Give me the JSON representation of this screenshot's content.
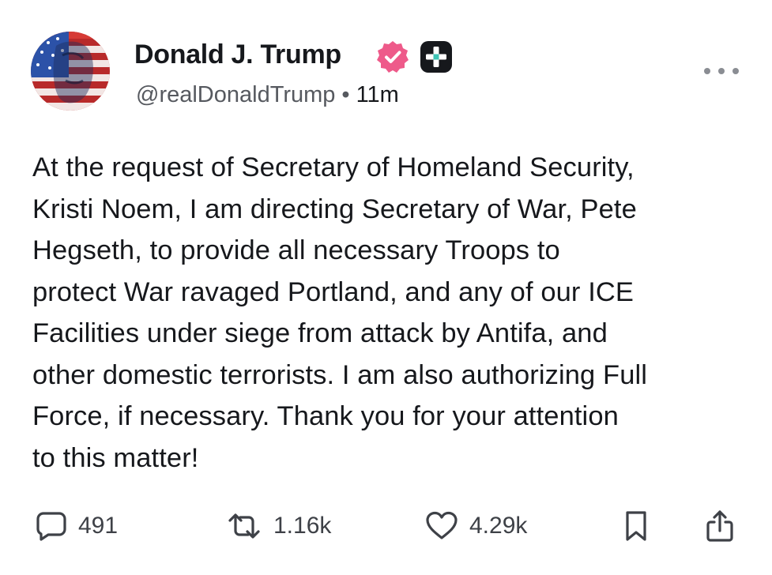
{
  "author": {
    "display_name": "Donald J. Trump",
    "handle": "@realDonaldTrump",
    "separator": "•",
    "time_ago": "11m",
    "verified_color": "#ee5a8a"
  },
  "post": {
    "text": "At the request of Secretary of Homeland Security,\nKristi Noem, I am directing Secretary of War, Pete\nHegseth, to provide all necessary Troops to\nprotect War ravaged Portland, and any of our ICE\nFacilities under siege from attack by Antifa, and\nother domestic terrorists. I am also authorizing Full\nForce, if necessary. Thank you for your attention\nto this matter!"
  },
  "actions": {
    "replies": "491",
    "retruths": "1.16k",
    "likes": "4.29k"
  },
  "icons": {
    "avatar": "american-flag-portrait",
    "verified": "verified-badge-icon",
    "badge": "plus-badge-icon",
    "more": "more-dots-icon",
    "reply": "speech-bubble-icon",
    "retruth": "repost-arrows-icon",
    "like": "heart-icon",
    "bookmark": "bookmark-icon",
    "share": "share-icon"
  }
}
